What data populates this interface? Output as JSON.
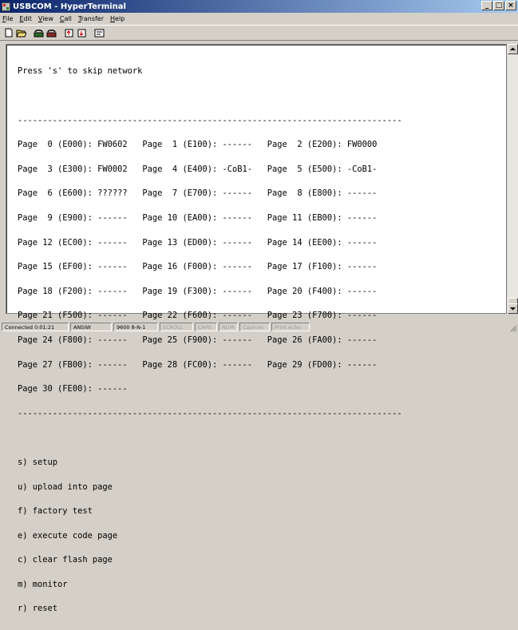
{
  "window": {
    "title": "USBCOM - HyperTerminal"
  },
  "window_buttons": [
    "_",
    "□",
    "×"
  ],
  "menu": [
    {
      "ul": "F",
      "rest": "ile"
    },
    {
      "ul": "E",
      "rest": "dit"
    },
    {
      "ul": "V",
      "rest": "iew"
    },
    {
      "ul": "C",
      "rest": "all"
    },
    {
      "ul": "T",
      "rest": "ransfer"
    },
    {
      "ul": "H",
      "rest": "elp"
    }
  ],
  "toolbar": {
    "buttons": [
      "new-icon",
      "open-icon",
      "call-icon",
      "disconnect-icon",
      "send-icon",
      "receive-icon",
      "properties-icon"
    ]
  },
  "terminal": {
    "lines": [
      "Press 's' to skip network",
      "",
      "-----------------------------------------------------------------------------",
      "Page  0 (E000): FW0602   Page  1 (E100): ------   Page  2 (E200): FW0000",
      "Page  3 (E300): FW0002   Page  4 (E400): -CoB1-   Page  5 (E500): -CoB1-",
      "Page  6 (E600): ??????   Page  7 (E700): ------   Page  8 (E800): ------",
      "Page  9 (E900): ------   Page 10 (EA00): ------   Page 11 (EB00): ------",
      "Page 12 (EC00): ------   Page 13 (ED00): ------   Page 14 (EE00): ------",
      "Page 15 (EF00): ------   Page 16 (F000): ------   Page 17 (F100): ------",
      "Page 18 (F200): ------   Page 19 (F300): ------   Page 20 (F400): ------",
      "Page 21 (F500): ------   Page 22 (F600): ------   Page 23 (F700): ------",
      "Page 24 (F800): ------   Page 25 (F900): ------   Page 26 (FA00): ------",
      "Page 27 (FB00): ------   Page 28 (FC00): ------   Page 29 (FD00): ------",
      "Page 30 (FE00): ------",
      "-----------------------------------------------------------------------------",
      "",
      "s) setup",
      "u) upload into page",
      "f) factory test",
      "e) execute code page",
      "c) clear flash page",
      "m) monitor",
      "r) reset"
    ]
  },
  "statusbar": {
    "connected": "Connected 0:01:21",
    "emulation": "ANSIW",
    "port_settings": "9600 8-N-1",
    "scroll": "SCROLL",
    "caps": "CAPS",
    "num": "NUM",
    "capture": "Capture",
    "print_echo": "Print echo"
  }
}
